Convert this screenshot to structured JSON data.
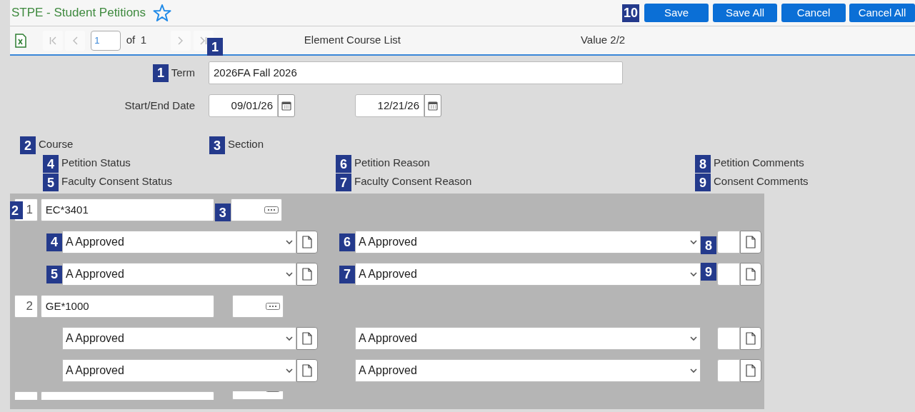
{
  "header": {
    "title": "STPE - Student Petitions",
    "callout": "10",
    "buttons": [
      {
        "label": "Save"
      },
      {
        "label": "Save All"
      },
      {
        "label": "Cancel"
      },
      {
        "label": "Cancel All"
      }
    ]
  },
  "toolbar": {
    "page": "1",
    "of_label": "of",
    "total": "1",
    "title": "Element Course List",
    "callout": "1",
    "value_label": "Value 2/2"
  },
  "term": {
    "callout": "1",
    "label": "Term",
    "value": "2026FA Fall 2026"
  },
  "dates": {
    "label": "Start/End Date",
    "start": "09/01/26",
    "end": "12/21/26"
  },
  "column_headers": {
    "course": {
      "callout": "2",
      "label": "Course"
    },
    "section": {
      "callout": "3",
      "label": "Section"
    },
    "petition_status": {
      "callout": "4",
      "label": "Petition Status"
    },
    "consent_status": {
      "callout": "5",
      "label": "Faculty Consent Status"
    },
    "petition_reason": {
      "callout": "6",
      "label": "Petition Reason"
    },
    "consent_reason": {
      "callout": "7",
      "label": "Faculty Consent Reason"
    },
    "petition_comments": {
      "callout": "8",
      "label": "Petition Comments"
    },
    "consent_comments": {
      "callout": "9",
      "label": "Consent Comments"
    }
  },
  "rows": [
    {
      "number": "1",
      "course": "EC*3401",
      "petition_status": "A Approved",
      "consent_status": "A Approved",
      "petition_reason": "A Approved",
      "consent_reason": "A Approved",
      "callouts": {
        "number": "2",
        "section": "3",
        "petition_status": "4",
        "consent_status": "5",
        "petition_reason": "6",
        "consent_reason": "7",
        "petition_comments": "8",
        "consent_comments": "9"
      }
    },
    {
      "number": "2",
      "course": "GE*1000",
      "petition_status": "A Approved",
      "consent_status": "A Approved",
      "petition_reason": "A Approved",
      "consent_reason": "A Approved"
    },
    {
      "cut_off": true
    }
  ]
}
